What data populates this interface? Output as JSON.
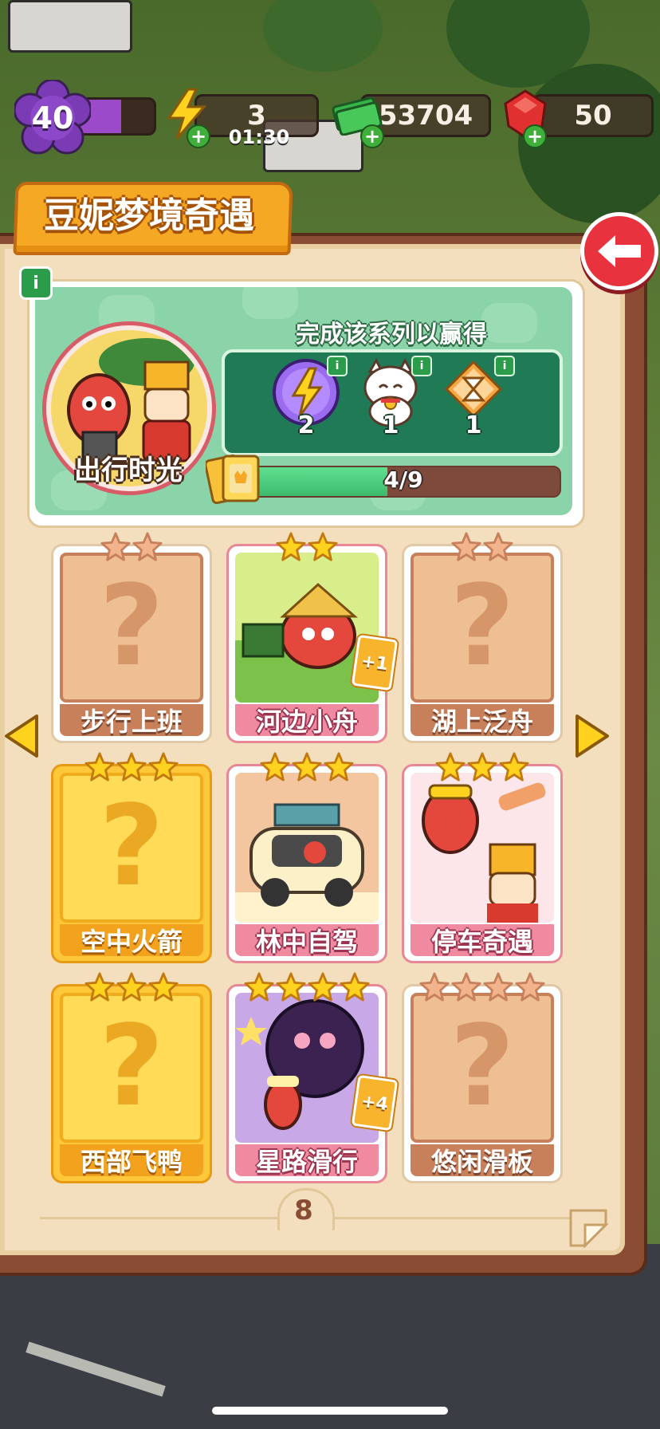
{
  "hud": {
    "level": "40",
    "level_progress": 0.55,
    "energy": "3",
    "energy_timer": "01:30",
    "cash": "53704",
    "gems": "50"
  },
  "title": "豆妮梦境奇遇",
  "series": {
    "name": "出行时光",
    "reward_title": "完成该系列以赢得",
    "rewards": [
      {
        "icon": "lightning-orb-icon",
        "count": "2"
      },
      {
        "icon": "lucky-cat-icon",
        "count": "1"
      },
      {
        "icon": "hourglass-icon",
        "count": "1"
      }
    ],
    "progress_text": "4/9",
    "progress_value": 0.444
  },
  "cards": [
    {
      "name": "步行上班",
      "stars": 2,
      "state": "locked-plain"
    },
    {
      "name": "河边小舟",
      "stars": 2,
      "state": "owned",
      "extra": "+1"
    },
    {
      "name": "湖上泛舟",
      "stars": 2,
      "state": "locked-plain"
    },
    {
      "name": "空中火箭",
      "stars": 3,
      "state": "locked-gold"
    },
    {
      "name": "林中自驾",
      "stars": 3,
      "state": "owned"
    },
    {
      "name": "停车奇遇",
      "stars": 3,
      "state": "owned"
    },
    {
      "name": "西部飞鸭",
      "stars": 3,
      "state": "locked-gold"
    },
    {
      "name": "星路滑行",
      "stars": 4,
      "state": "owned",
      "extra": "+4"
    },
    {
      "name": "悠闲滑板",
      "stars": 4,
      "state": "locked-plain"
    }
  ],
  "page_number": "8",
  "colors": {
    "accent": "#f5a823",
    "back_button": "#e8333e",
    "progress": "#3cbb6c",
    "book": "#8a4c33"
  }
}
